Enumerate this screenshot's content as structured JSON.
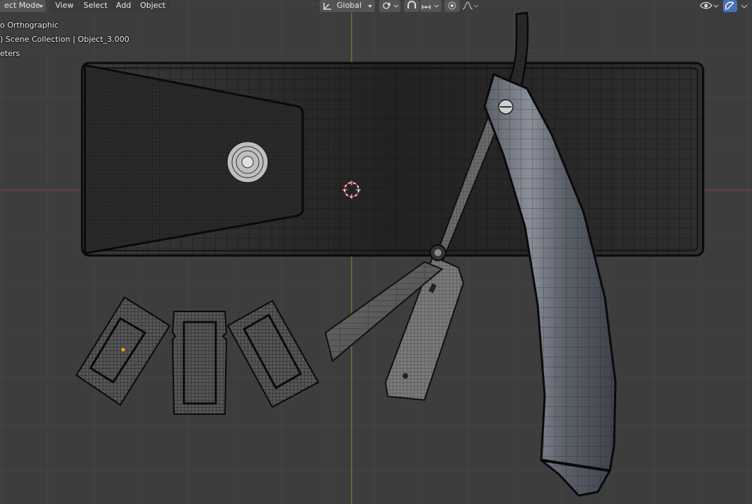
{
  "header": {
    "mode_label": "ect Mode",
    "menu_view": "View",
    "menu_select": "Select",
    "menu_add": "Add",
    "menu_object": "Object",
    "orientation_label": "Global",
    "icons": [
      "transform-orientation-icon",
      "pivot-icon",
      "snap-icon",
      "snap-target-icon",
      "proportional-edit-icon",
      "falloff-icon",
      "visibility-icon",
      "gizmo-icon"
    ]
  },
  "overlay": {
    "view_name": "o Orthographic",
    "collection_info": ") Scene Collection | Object_3.000",
    "units": "eters"
  },
  "colors": {
    "background": "#3d3d3d",
    "grid": "#4a4a4a",
    "x_axis": "#8a3a3a",
    "y_axis": "#6a8a22",
    "wire": "#101010",
    "header_button": "#545454"
  }
}
